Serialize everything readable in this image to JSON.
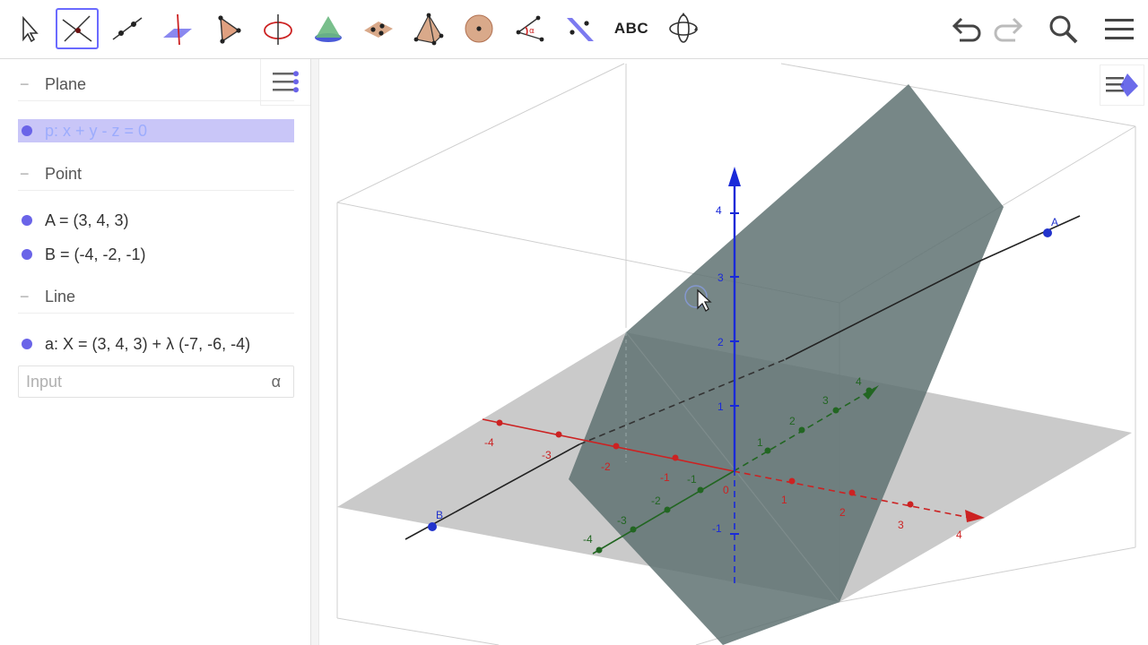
{
  "toolbar": {
    "tools": [
      {
        "name": "move",
        "icon": "arrow-cursor-icon"
      },
      {
        "name": "intersect",
        "icon": "intersect-icon"
      },
      {
        "name": "line",
        "icon": "line-icon"
      },
      {
        "name": "perpendicular-line",
        "icon": "perpendicular-icon"
      },
      {
        "name": "polygon",
        "icon": "polygon-icon"
      },
      {
        "name": "circle-axis",
        "icon": "circle-axis-icon"
      },
      {
        "name": "cone",
        "icon": "cone-icon"
      },
      {
        "name": "plane-three-points",
        "icon": "plane-points-icon"
      },
      {
        "name": "pyramid",
        "icon": "pyramid-icon"
      },
      {
        "name": "sphere",
        "icon": "sphere-icon"
      },
      {
        "name": "angle",
        "icon": "angle-icon"
      },
      {
        "name": "reflect",
        "icon": "reflect-icon"
      },
      {
        "name": "text",
        "icon": "text-icon",
        "label": "ABC"
      },
      {
        "name": "rotate-view",
        "icon": "rotate-view-icon"
      }
    ],
    "selected_tool": "intersect",
    "undo_icon": "undo-icon",
    "redo_icon": "redo-icon",
    "search_icon": "search-icon",
    "menu_icon": "hamburger-menu-icon"
  },
  "algebra": {
    "groups": [
      {
        "label": "Plane",
        "items": [
          {
            "text": "p: x + y - z = 0",
            "selected": true
          }
        ]
      },
      {
        "label": "Point",
        "items": [
          {
            "text": "A = (3, 4, 3)"
          },
          {
            "text": "B = (-4, -2, -1)"
          }
        ]
      },
      {
        "label": "Line",
        "items": [
          {
            "text": "a: X = (3, 4, 3) + λ (-7, -6, -4)"
          }
        ]
      }
    ],
    "input_placeholder": "Input",
    "input_alpha": "α"
  },
  "graphics": {
    "point_A": "A",
    "point_B": "B",
    "x_ticks": [
      "-4",
      "-3",
      "-2",
      "-1",
      "0",
      "1",
      "2",
      "3",
      "4"
    ],
    "y_ticks": [
      "-4",
      "-3",
      "-2",
      "-1",
      "1",
      "2",
      "3",
      "4"
    ],
    "z_ticks": [
      "-1",
      "1",
      "2",
      "3",
      "4"
    ],
    "colors": {
      "x_axis": "#cc2222",
      "y_axis": "#226622",
      "z_axis": "#1a2ad8",
      "points": "#2233cc",
      "plane_p": "#5f7272",
      "xy_plane": "#b6b6b6",
      "selection": "#c9c6f8",
      "algebra_dot": "#6a64e8"
    }
  }
}
